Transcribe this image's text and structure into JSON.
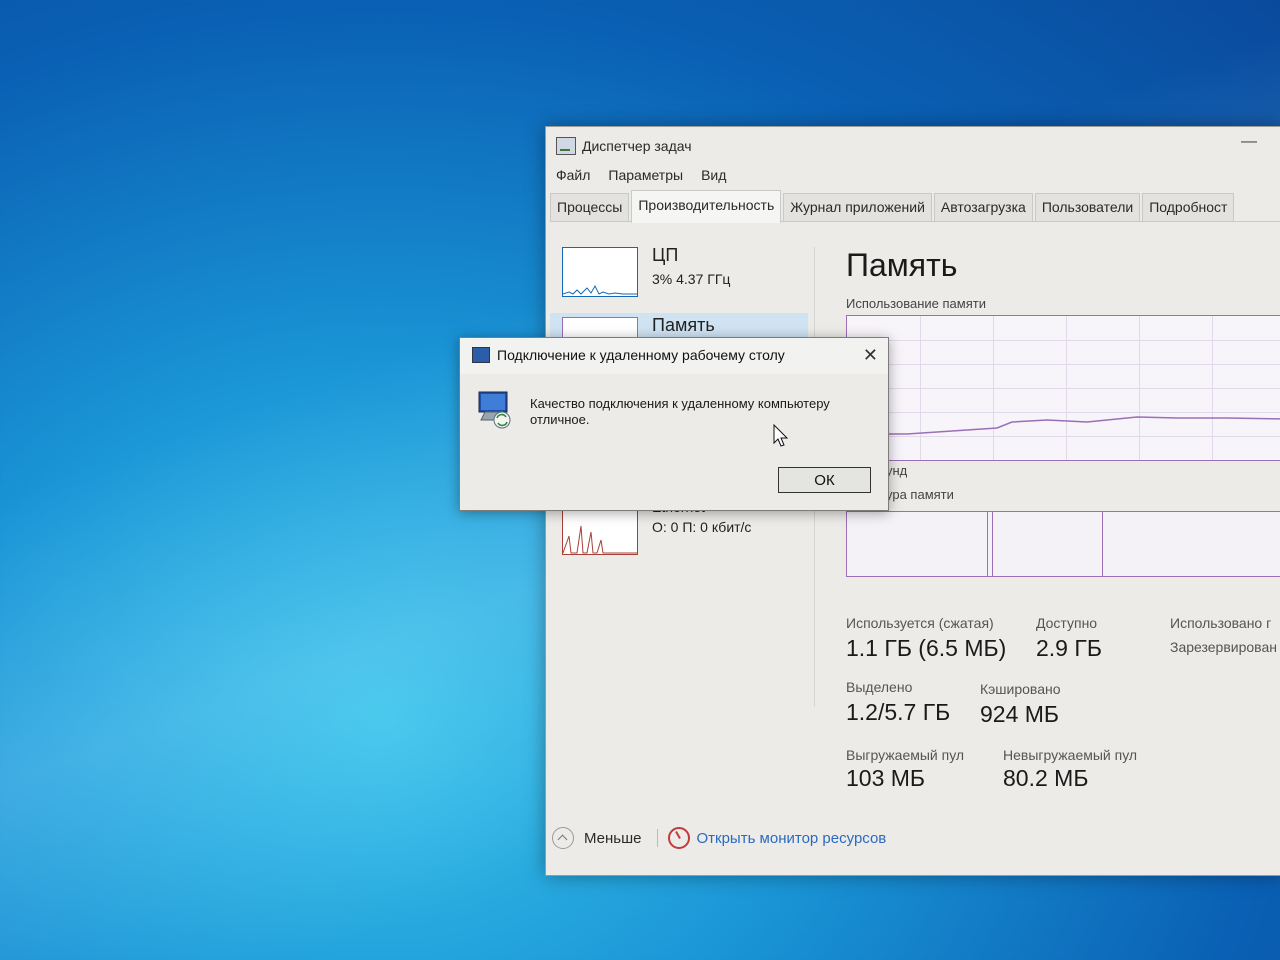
{
  "task_manager": {
    "title": "Диспетчер задач",
    "menu": [
      "Файл",
      "Параметры",
      "Вид"
    ],
    "tabs": [
      "Процессы",
      "Производительность",
      "Журнал приложений",
      "Автозагрузка",
      "Пользователи",
      "Подробност"
    ],
    "active_tab_index": 1,
    "resources": [
      {
        "name": "ЦП",
        "sub": "3% 4.37 ГГц",
        "selected": false
      },
      {
        "name": "Память",
        "sub": "",
        "selected": true
      },
      {
        "name": "Ethernet",
        "sub": "О: 0 П: 0 кбит/с",
        "selected": false
      }
    ],
    "memory": {
      "title": "Память",
      "usage_label": "Использование памяти",
      "partial_label_1": "унд",
      "partial_label_2": "ура памяти",
      "stats": {
        "in_use_label": "Используется (сжатая)",
        "in_use_value": "1.1 ГБ (6.5 МБ)",
        "available_label": "Доступно",
        "available_value": "2.9 ГБ",
        "used_label_partial": "Использовано г",
        "reserved_label_partial": "Зарезервирован",
        "committed_label": "Выделено",
        "committed_value": "1.2/5.7 ГБ",
        "cached_label": "Кэшировано",
        "cached_value": "924 МБ",
        "paged_label": "Выгружаемый пул",
        "paged_value": "103 МБ",
        "nonpaged_label": "Невыгружаемый пул",
        "nonpaged_value": "80.2 МБ"
      }
    },
    "footer": {
      "less_label": "Меньше",
      "resmon_label": "Открыть монитор ресурсов"
    },
    "colors": {
      "memory_line": "#9b6fb8",
      "cpu_line": "#1768b3",
      "net_line": "#a8403a",
      "link": "#2a6bc2"
    }
  },
  "rdp_dialog": {
    "title": "Подключение к удаленному рабочему столу",
    "message": "Качество подключения к удаленному компьютеру отличное.",
    "ok_label": "ОК"
  }
}
